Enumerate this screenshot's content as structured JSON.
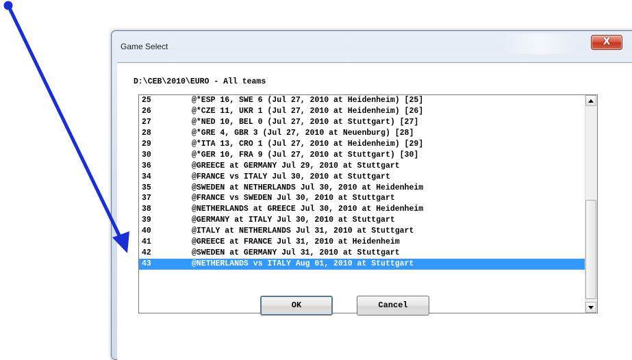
{
  "window": {
    "title": "Game Select",
    "close_label": "X"
  },
  "path_label": "D:\\CEB\\2010\\EURO - All teams",
  "games": [
    {
      "num": "25",
      "text": "@*ESP 16, SWE 6 (Jul 27, 2010 at Heidenheim) [25]"
    },
    {
      "num": "26",
      "text": "@*CZE 11, UKR 1 (Jul 27, 2010 at Heidenheim) [26]"
    },
    {
      "num": "27",
      "text": "@*NED 10, BEL 0 (Jul 27, 2010 at Stuttgart) [27]"
    },
    {
      "num": "28",
      "text": "@*GRE 4, GBR 3 (Jul 27, 2010 at Neuenburg) [28]"
    },
    {
      "num": "29",
      "text": "@*ITA 13, CRO 1 (Jul 27, 2010 at Heidenheim) [29]"
    },
    {
      "num": "30",
      "text": "@*GER 10, FRA 9 (Jul 27, 2010 at Stuttgart) [30]"
    },
    {
      "num": "36",
      "text": "@GREECE at GERMANY  Jul 29, 2010 at Stuttgart"
    },
    {
      "num": "34",
      "text": "@FRANCE vs ITALY  Jul 30, 2010 at Stuttgart"
    },
    {
      "num": "35",
      "text": "@SWEDEN at NETHERLANDS  Jul 30, 2010 at Heidenheim"
    },
    {
      "num": "37",
      "text": "@FRANCE vs SWEDEN  Jul 30, 2010 at Stuttgart"
    },
    {
      "num": "38",
      "text": "@NETHERLANDS at GREECE  Jul 30, 2010 at Heidenheim"
    },
    {
      "num": "39",
      "text": "@GERMANY at ITALY  Jul 30, 2010 at Stuttgart"
    },
    {
      "num": "40",
      "text": "@ITALY at NETHERLANDS  Jul 31, 2010 at Stuttgart"
    },
    {
      "num": "41",
      "text": "@GREECE at FRANCE  Jul 31, 2010 at Heidenheim"
    },
    {
      "num": "42",
      "text": "@SWEDEN at GERMANY  Jul 31, 2010 at Stuttgart"
    },
    {
      "num": "43",
      "text": "@NETHERLANDS vs ITALY  Aug 01, 2010 at Stuttgart",
      "selected": true
    }
  ],
  "buttons": {
    "ok": "OK",
    "cancel": "Cancel"
  },
  "colors": {
    "selection": "#3399ff",
    "annotation_arrow": "#1a2ed6"
  }
}
